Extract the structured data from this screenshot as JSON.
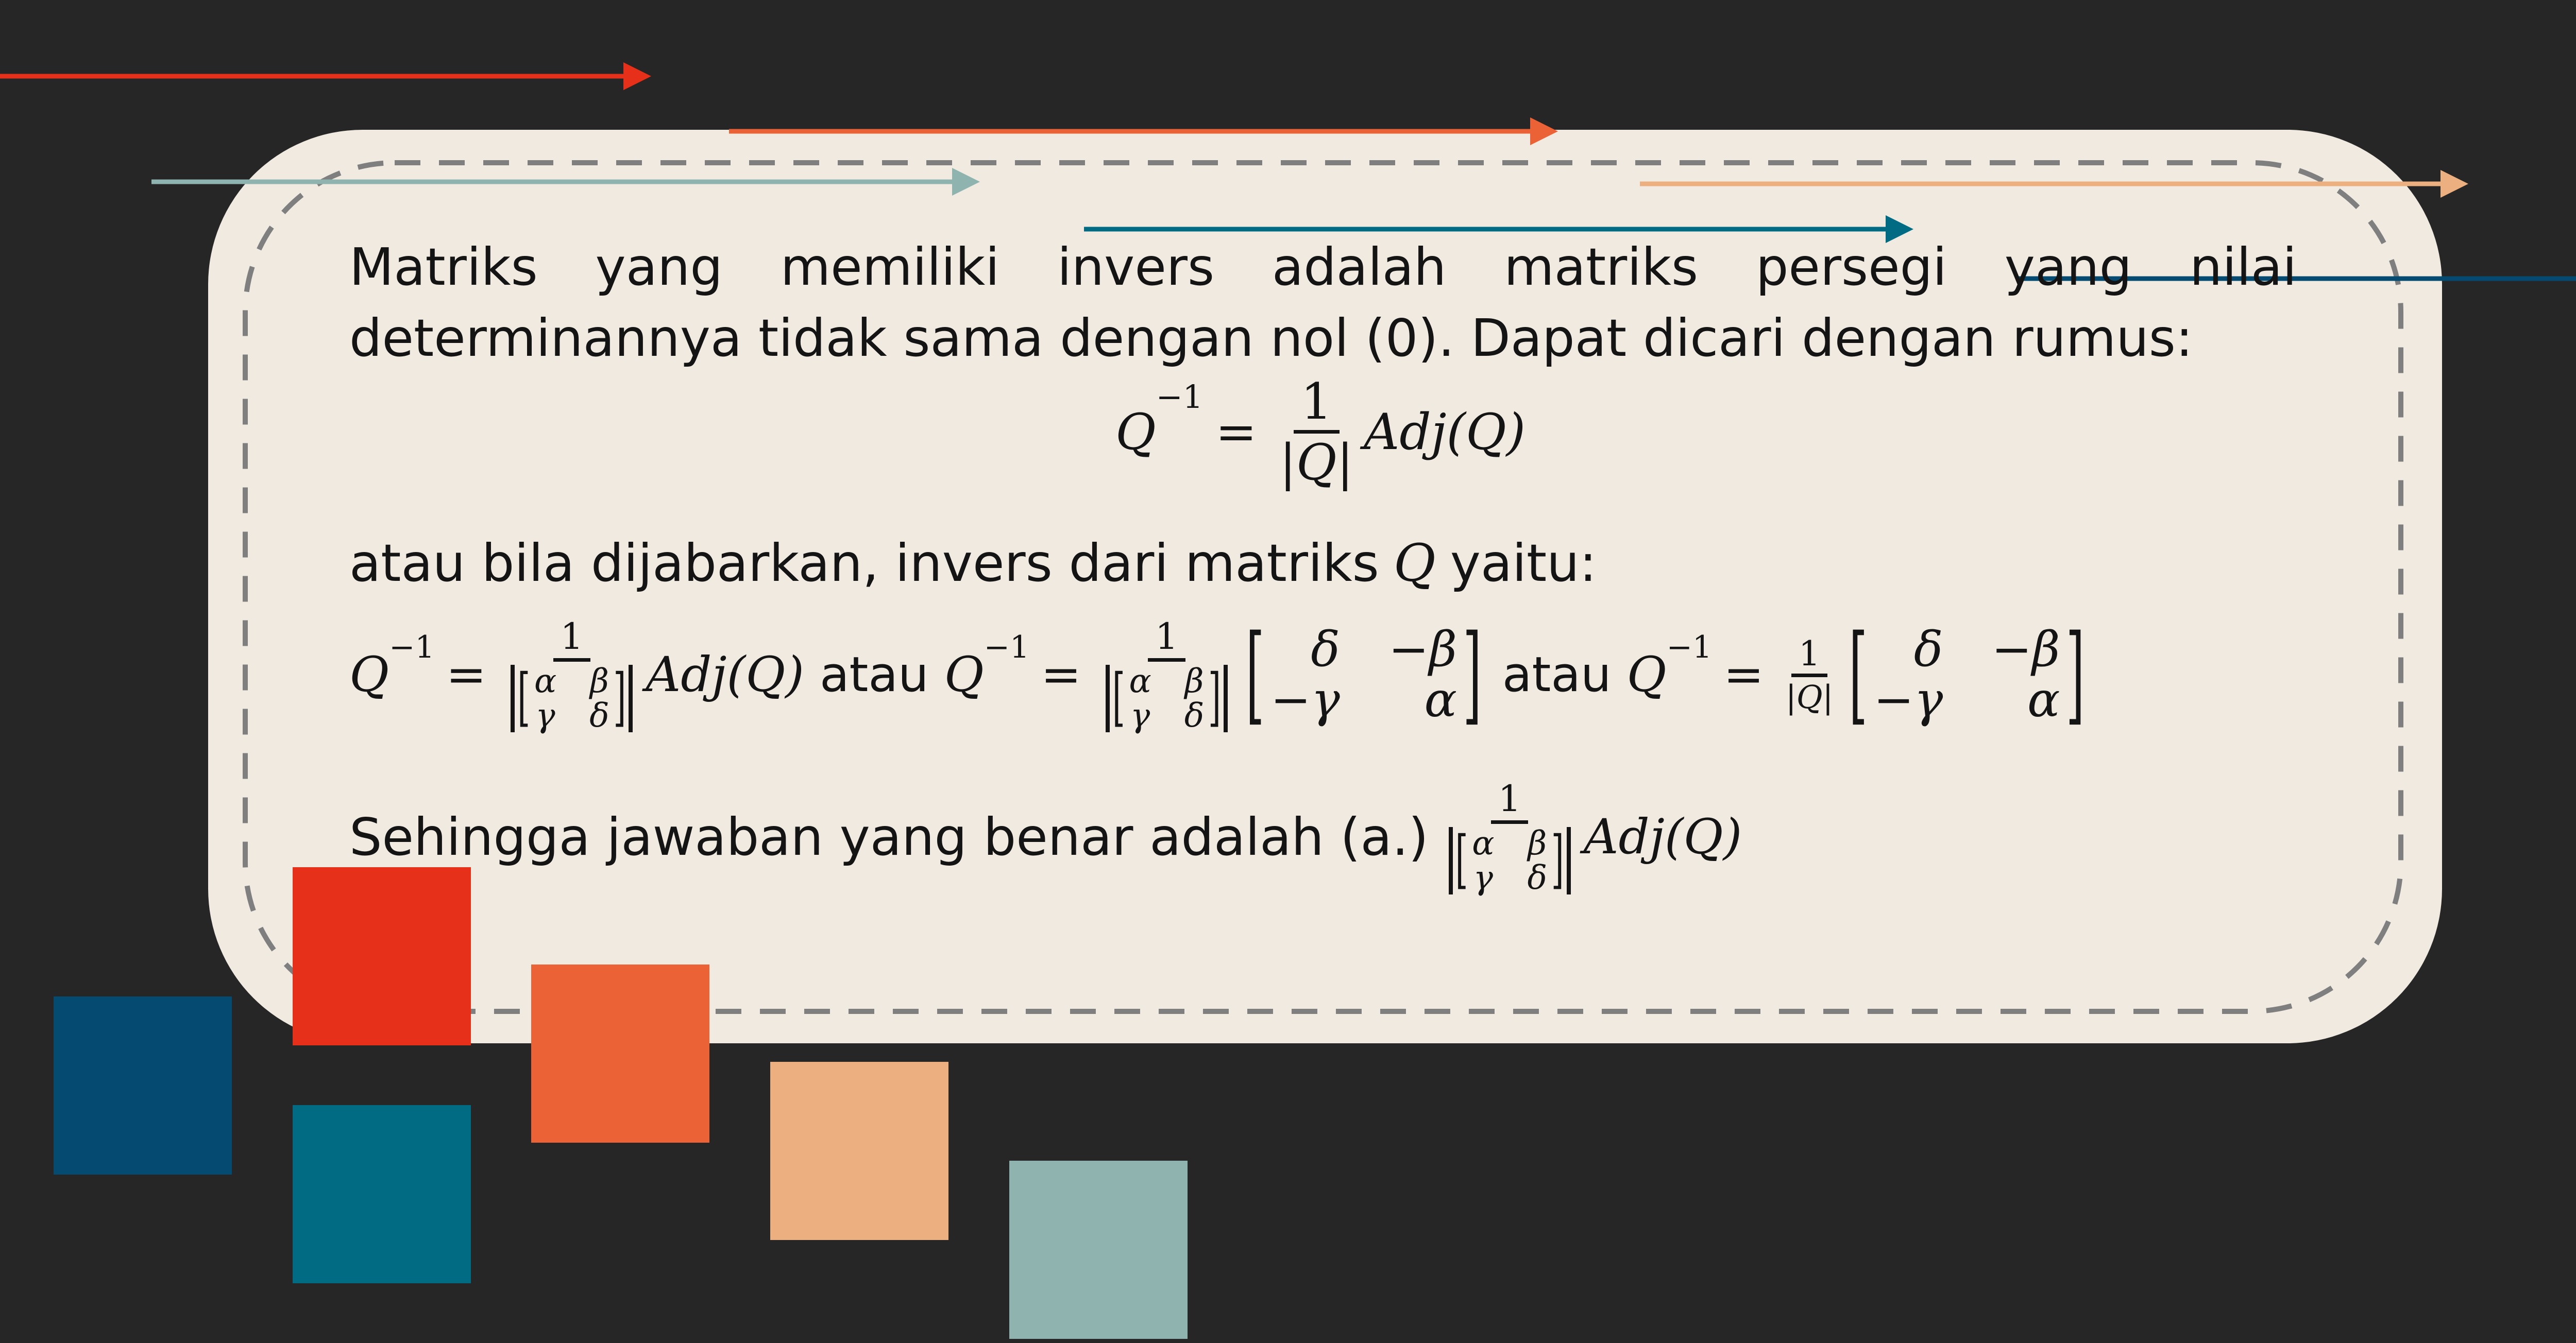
{
  "colors": {
    "background": "#262626",
    "card": "#F0EAE1",
    "dashed_border": "#7F7F7F",
    "red": "#E73019",
    "orange": "#EC6237",
    "peach": "#EBAF80",
    "sage": "#8FB4AF",
    "teal": "#006B83",
    "navy": "#054A70"
  },
  "content": {
    "intro": "Matriks yang memiliki invers adalah matriks persegi yang nilai determinannya tidak sama dengan nol (0). Dapat dicari dengan rumus:",
    "formula1": {
      "lhs": "Q",
      "lhs_sup": "−1",
      "eq": "=",
      "num": "1",
      "den": "|Q|",
      "rhs": "Adj(Q)"
    },
    "explain": {
      "text": "atau bila dijabarkan, invers dari matriks",
      "var": "Q",
      "tail": "yaitu:"
    },
    "formula2": {
      "q": "Q",
      "sup": "−1",
      "eq": "=",
      "one": "1",
      "adj": "Adj(Q)",
      "atau": "atau",
      "det_den": "|Q|",
      "m": {
        "a": "α",
        "b": "β",
        "c": "γ",
        "d": "δ",
        "delta": "δ",
        "neg_beta": "−β",
        "neg_gamma": "−γ",
        "alpha": "α"
      }
    },
    "conclusion": {
      "text": "Sehingga jawaban yang benar adalah (a.)",
      "one": "1",
      "adj": "Adj(Q)"
    }
  }
}
